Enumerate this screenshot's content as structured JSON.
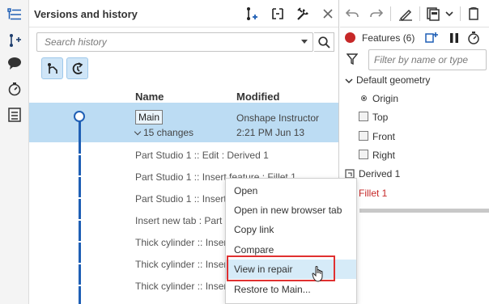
{
  "rail": {
    "items": [
      {
        "name": "feature-list-icon"
      },
      {
        "name": "branch-add-icon"
      },
      {
        "name": "comment-icon"
      },
      {
        "name": "stopwatch-icon"
      },
      {
        "name": "checklist-icon"
      }
    ]
  },
  "versions_panel": {
    "title": "Versions and history",
    "search_placeholder": "Search history",
    "columns": {
      "name": "Name",
      "modified": "Modified"
    },
    "selected": {
      "branch": "Main",
      "changes": "15 changes",
      "author": "Onshape Instructor",
      "time": "2:21 PM Jun 13"
    },
    "history": [
      "Part Studio 1 :: Edit : Derived 1",
      "Part Studio 1 :: Insert feature : Fillet 1",
      "Part Studio 1 :: Insert feature : Derived 1",
      "Insert new tab : Part Studio 1",
      "Thick cylinder :: Insert feature : Fillet 1",
      "Thick cylinder :: Insert feature : Extrude 1",
      "Thick cylinder :: Insert feature : Sketch 1"
    ]
  },
  "context_menu": {
    "items": [
      "Open",
      "Open in new browser tab",
      "Copy link",
      "Compare",
      "View in repair",
      "Restore to Main..."
    ],
    "highlighted": "View in repair"
  },
  "features_panel": {
    "title": "Features (6)",
    "filter_placeholder": "Filter by name or type",
    "group": "Default geometry",
    "items": [
      {
        "label": "Origin",
        "type": "origin"
      },
      {
        "label": "Top",
        "type": "plane"
      },
      {
        "label": "Front",
        "type": "plane"
      },
      {
        "label": "Right",
        "type": "plane"
      }
    ],
    "features": [
      {
        "label": "Derived 1",
        "status": "ok"
      },
      {
        "label": "Fillet 1",
        "status": "error"
      }
    ]
  },
  "colors": {
    "accent": "#1f5fb5",
    "selected_row": "#bcdcf3",
    "error": "#c62828",
    "highlight_box": "#e03030"
  }
}
